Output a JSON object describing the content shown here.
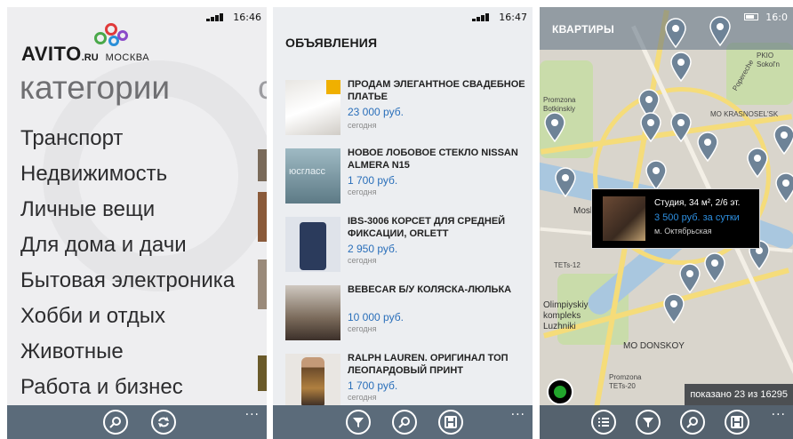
{
  "status": {
    "screen1_time": "16:46",
    "screen2_time": "16:47",
    "screen3_time": "16:0"
  },
  "screen1": {
    "logo_text": "AVITO",
    "logo_suffix": ".RU",
    "city": "МОСКВА",
    "heading": "категории",
    "peek_heading_char": "с",
    "categories": [
      "Транспорт",
      "Недвижимость",
      "Личные вещи",
      "Для дома и дачи",
      "Бытовая электроника",
      "Хобби и отдых",
      "Животные",
      "Работа и бизнес"
    ],
    "appbar": {
      "icons": [
        "search-icon",
        "refresh-icon"
      ],
      "more": "..."
    }
  },
  "screen2": {
    "heading": "ОБЪЯВЛЕНИЯ",
    "ads": [
      {
        "title": "ПРОДАМ ЭЛЕГАНТНОЕ СВАДЕБНОЕ ПЛАТЬЕ",
        "price": "23 000 руб.",
        "date": "сегодня",
        "premium": true
      },
      {
        "title": "НОВОЕ ЛОБОВОЕ СТЕКЛО NISSAN ALMERA N15",
        "price": "1 700 руб.",
        "date": "сегодня",
        "premium": false
      },
      {
        "title": "IBS-3006 КОРСЕТ ДЛЯ СРЕДНЕЙ ФИКСАЦИИ, ORLETT",
        "price": "2 950 руб.",
        "date": "сегодня",
        "premium": false
      },
      {
        "title": "BEBECAR Б/У КОЛЯСКА-ЛЮЛЬКА",
        "price": "10 000 руб.",
        "date": "сегодня",
        "premium": false
      },
      {
        "title": "RALPH LAUREN. ОРИГИНАЛ ТОП ЛЕОПАРДОВЫЙ ПРИНТ",
        "price": "1 700 руб.",
        "date": "сегодня",
        "premium": false
      }
    ],
    "thumb_text_2": "юсгласс",
    "appbar": {
      "icons": [
        "filter-icon",
        "search-icon",
        "save-icon"
      ],
      "more": "..."
    }
  },
  "screen3": {
    "heading": "КВАРТИРЫ",
    "map_labels": {
      "promzona": "Promzona Botkinskiy",
      "tets12": "TETs-12",
      "olimp": "Olimpiyskiy kompleks Luzhniki",
      "donskoy": "MO DONSKOY",
      "krasnosel": "MO KRASNOSEL'SK",
      "promzona2": "Promzona TETs-20",
      "sokol": "PKIO Sokol'n",
      "mos": "Mosk",
      "popere": "Popereche"
    },
    "info": {
      "line1": "Студия, 34 м², 2/6 эт.",
      "line2": "3 500 руб. за сутки",
      "line3": "м. Октябрьская"
    },
    "counter": "показано 23 из 16295",
    "appbar": {
      "icons": [
        "list-icon",
        "filter-icon",
        "search-icon",
        "save-icon"
      ],
      "more": "..."
    }
  },
  "colors": {
    "appbar": "#5b6b7a",
    "price_blue": "#2a6fba",
    "info_blue": "#2d8fe0",
    "pin": "#6e8397"
  }
}
